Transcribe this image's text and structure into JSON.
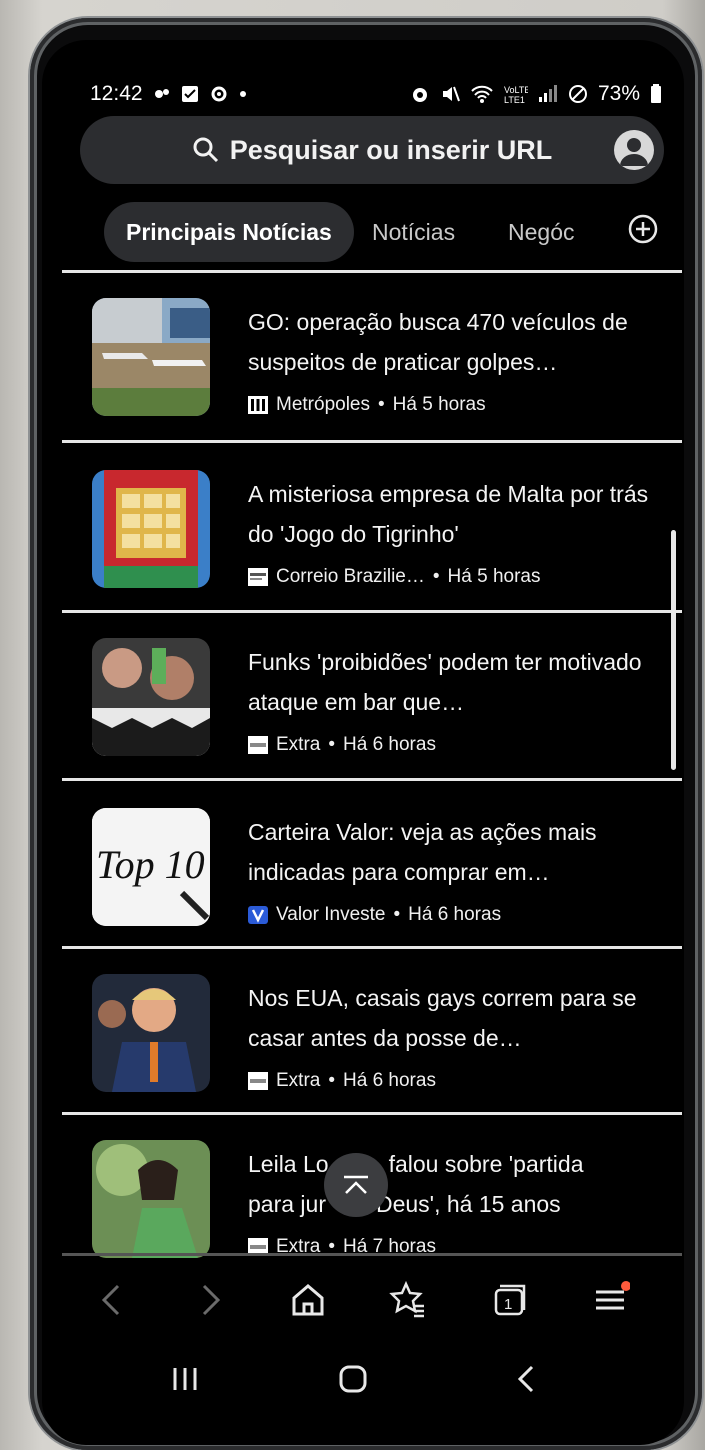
{
  "status_bar": {
    "time": "12:42",
    "battery": "73%"
  },
  "search": {
    "placeholder": "Pesquisar ou inserir URL",
    "icon": "search-icon"
  },
  "tabs": [
    {
      "label": "Principais Notícias",
      "active": true
    },
    {
      "label": "Notícias",
      "active": false
    },
    {
      "label": "Negóc",
      "active": false
    }
  ],
  "news": [
    {
      "title": "GO: operação busca 470 veículos de suspeitos de praticar golpes…",
      "source": "Metrópoles",
      "time": "Há 5 horas",
      "separator": "•"
    },
    {
      "title": "A misteriosa empresa de Malta por trás do 'Jogo do Tigrinho'",
      "source": "Correio Brazilie…",
      "time": "Há 5 horas",
      "separator": "•"
    },
    {
      "title": "Funks 'proibidões' podem ter motivado ataque em bar que…",
      "source": "Extra",
      "time": "Há 6 horas",
      "separator": "•"
    },
    {
      "title": "Carteira Valor: veja as ações mais indicadas para comprar em…",
      "source": "Valor Investe",
      "time": "Há 6 horas",
      "separator": "•",
      "thumb_text": "Top 10"
    },
    {
      "title": "Nos EUA, casais gays correm para se casar antes da posse de…",
      "source": "Extra",
      "time": "Há 6 horas",
      "separator": "•"
    },
    {
      "title": "Leila Lo…falou sobre 'partida para jur… Deus', há 15 anos",
      "title_line1": "Leila Lo",
      "title_line1b": "falou sobre 'partida",
      "title_line2": "para jur",
      "title_line2b": "Deus', há 15 anos",
      "source": "Extra",
      "time": "Há 7 horas",
      "separator": "•"
    }
  ],
  "colors": {
    "background": "#000000",
    "surface": "#2c2d30",
    "text": "#f4f4f4",
    "notification_dot": "#ff5a3c"
  }
}
